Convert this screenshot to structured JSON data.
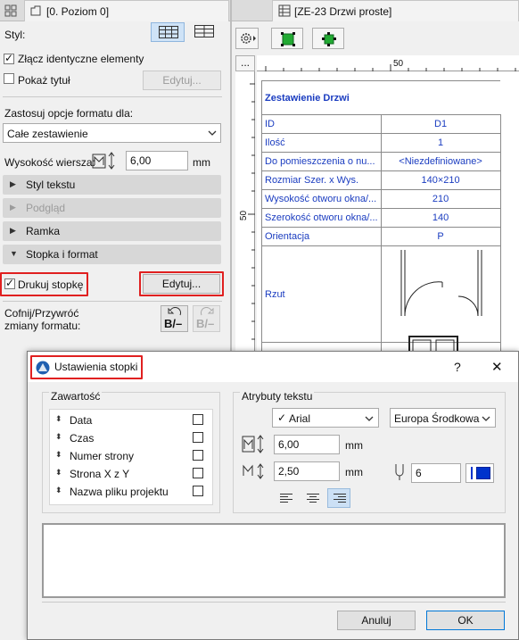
{
  "left_tab": {
    "title": "[0. Poziom 0]"
  },
  "right_tab": {
    "title": "[ZE-23 Drzwi proste]"
  },
  "panel": {
    "style_label": "Styl:",
    "merge_label": "Złącz identyczne elementy",
    "merge_checked": true,
    "show_title_label": "Pokaż tytuł",
    "show_title_checked": false,
    "edit_label_1": "Edytuj...",
    "apply_format_label": "Zastosuj opcje formatu dla:",
    "apply_format_value": "Całe zestawienie",
    "row_height_label": "Wysokość wiersza:",
    "row_height_value": "6,00",
    "row_height_unit": "mm",
    "sections": [
      {
        "label": "Styl tekstu",
        "arrow": "▶",
        "dim": false
      },
      {
        "label": "Podgląd",
        "arrow": "▶",
        "dim": true
      },
      {
        "label": "Ramka",
        "arrow": "▶",
        "dim": false
      },
      {
        "label": "Stopka i format",
        "arrow": "▼",
        "dim": false
      }
    ],
    "print_footer_label": "Drukuj stopkę",
    "print_footer_checked": true,
    "edit_label_2": "Edytuj...",
    "undo_label_1": "Cofnij/Przywróć",
    "undo_label_2": "zmiany formatu:",
    "undo_icon_text": "B/–",
    "redo_icon_text": "B/–"
  },
  "ruler": {
    "top_mark": "50",
    "left_mark": "50",
    "menu_btn": "..."
  },
  "schedule": {
    "title": "Zestawienie Drzwi",
    "rows": [
      {
        "k": "ID",
        "v": "D1"
      },
      {
        "k": "Ilość",
        "v": "1"
      },
      {
        "k": "Do pomieszczenia o nu...",
        "v": "<Niezdefiniowane>"
      },
      {
        "k": "Rozmiar Szer. x Wys.",
        "v": "140×210"
      },
      {
        "k": "Wysokość otworu okna/...",
        "v": "210"
      },
      {
        "k": "Szerokość otworu okna/...",
        "v": "140"
      },
      {
        "k": "Orientacja",
        "v": "P"
      }
    ],
    "plan_label": "Rzut"
  },
  "dialog": {
    "title": "Ustawienia stopki",
    "help": "?",
    "close": "✕",
    "content_group": "Zawartość",
    "items": [
      "Data",
      "Czas",
      "Numer strony",
      "Strona X z Y",
      "Nazwa pliku projektu"
    ],
    "text_attr_group": "Atrybuty tekstu",
    "font": "Arial",
    "font_check": "✓",
    "encoding": "Europa Środkowa",
    "size1": "6,00",
    "size2": "2,50",
    "unit": "mm",
    "pen_number": "6",
    "pen_color": "#0033cc",
    "cancel": "Anuluj",
    "ok": "OK"
  }
}
